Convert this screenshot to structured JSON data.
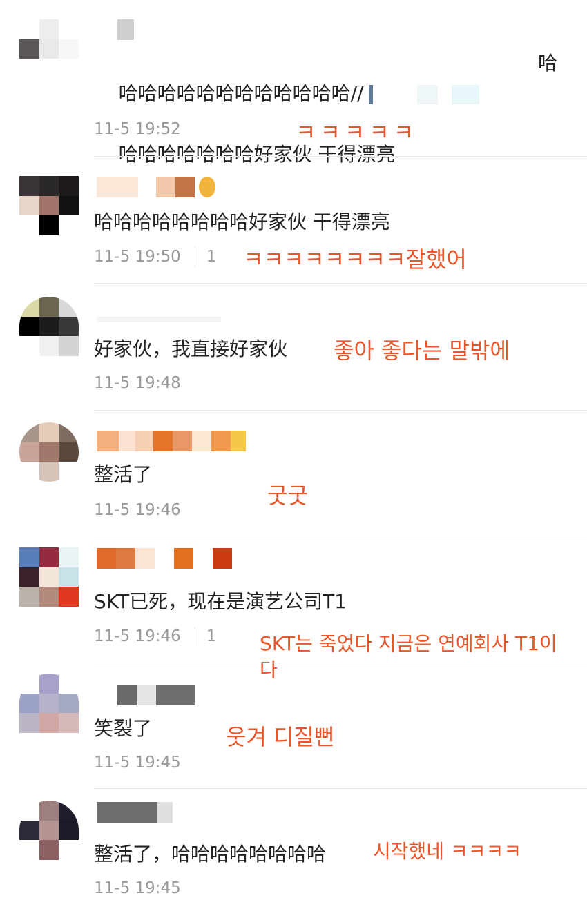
{
  "comments": [
    {
      "text": "哈哈哈哈哈哈哈哈哈哈哈哈//",
      "text_cont": "哈",
      "text2": "哈哈哈哈哈哈哈好家伙 干得漂亮",
      "time": "11-5 19:52",
      "likes": "",
      "annotation": "ㅋㅋㅋㅋㅋ"
    },
    {
      "text": "哈哈哈哈哈哈哈哈好家伙 干得漂亮",
      "time": "11-5 19:50",
      "likes": "1",
      "annotation": "ㅋㅋㅋㅋㅋㅋㅋㅋ잘했어"
    },
    {
      "text": "好家伙，我直接好家伙",
      "time": "11-5 19:48",
      "likes": "",
      "annotation": "좋아 좋다는 말밖에"
    },
    {
      "text": "整活了",
      "time": "11-5 19:46",
      "likes": "",
      "annotation": "굿굿"
    },
    {
      "text": "SKT已死，现在是演艺公司T1",
      "time": "11-5 19:46",
      "likes": "1",
      "annotation": "SKT는 죽었다 지금은 연예회사 T1이\n다"
    },
    {
      "text": "笑裂了",
      "time": "11-5 19:45",
      "likes": "",
      "annotation": "웃겨 디질뻔"
    },
    {
      "text": "整活了，哈哈哈哈哈哈哈哈",
      "time": "11-5 19:45",
      "likes": "",
      "annotation": "시작했네 ㅋㅋㅋㅋ"
    }
  ],
  "colors": {
    "annotation": "#e8562a",
    "text": "#222222",
    "meta": "#9a9a9a"
  },
  "icons": {
    "user_badge": "vip-badge-icon"
  }
}
